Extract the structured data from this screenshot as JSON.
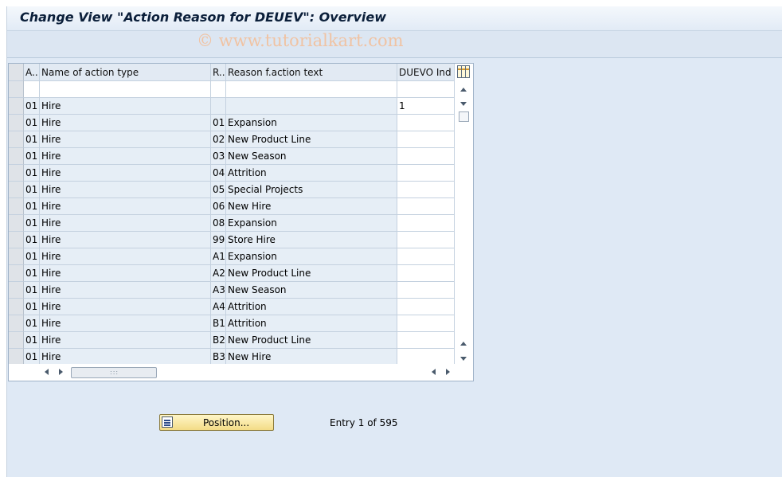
{
  "window": {
    "title": "Change View \"Action Reason for DEUEV\": Overview",
    "watermark": "© www.tutorialkart.com"
  },
  "table": {
    "columns": [
      "A..",
      "Name of action type",
      "R..",
      "Reason f.action text",
      "DUEVO Ind"
    ],
    "rows": [
      [
        "",
        "",
        "",
        "",
        ""
      ],
      [
        "01",
        "Hire",
        "",
        "",
        "1"
      ],
      [
        "01",
        "Hire",
        "01",
        "Expansion",
        ""
      ],
      [
        "01",
        "Hire",
        "02",
        "New Product Line",
        ""
      ],
      [
        "01",
        "Hire",
        "03",
        "New Season",
        ""
      ],
      [
        "01",
        "Hire",
        "04",
        "Attrition",
        ""
      ],
      [
        "01",
        "Hire",
        "05",
        "Special Projects",
        ""
      ],
      [
        "01",
        "Hire",
        "06",
        "New Hire",
        ""
      ],
      [
        "01",
        "Hire",
        "08",
        "Expansion",
        ""
      ],
      [
        "01",
        "Hire",
        "99",
        "Store Hire",
        ""
      ],
      [
        "01",
        "Hire",
        "A1",
        "Expansion",
        ""
      ],
      [
        "01",
        "Hire",
        "A2",
        "New Product Line",
        ""
      ],
      [
        "01",
        "Hire",
        "A3",
        "New Season",
        ""
      ],
      [
        "01",
        "Hire",
        "A4",
        "Attrition",
        ""
      ],
      [
        "01",
        "Hire",
        "B1",
        "Attrition",
        ""
      ],
      [
        "01",
        "Hire",
        "B2",
        "New Product Line",
        ""
      ],
      [
        "01",
        "Hire",
        "B3",
        "New Hire",
        ""
      ]
    ]
  },
  "footer": {
    "position_button": "Position...",
    "entry_text": "Entry 1 of 595"
  },
  "icons": {
    "table_settings": "table-settings-icon",
    "position": "position-icon",
    "scroll_up": "arrow-up-icon",
    "scroll_down": "arrow-down-icon",
    "scroll_left": "arrow-left-icon",
    "scroll_right": "arrow-right-icon"
  }
}
